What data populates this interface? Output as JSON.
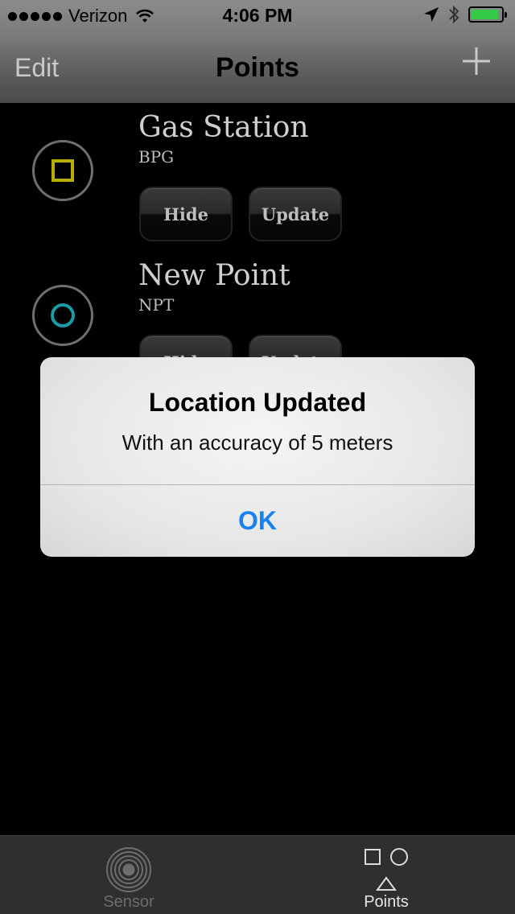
{
  "status_bar": {
    "carrier": "Verizon",
    "time": "4:06 PM"
  },
  "nav": {
    "edit_label": "Edit",
    "title": "Points"
  },
  "points": [
    {
      "name": "Gas Station",
      "code": "BPG",
      "hide_label": "Hide",
      "update_label": "Update",
      "symbol": "square-icon",
      "symbol_color": "#b5b000"
    },
    {
      "name": "New Point",
      "code": "NPT",
      "hide_label": "Hide",
      "update_label": "Update",
      "symbol": "circle-icon",
      "symbol_color": "#1b9aa8"
    }
  ],
  "alert": {
    "title": "Location Updated",
    "message": "With an accuracy of 5 meters",
    "ok_label": "OK"
  },
  "tab_bar": {
    "tabs": [
      {
        "label": "Sensor",
        "icon": "sensor-icon",
        "active": false
      },
      {
        "label": "Points",
        "icon": "shapes-icon",
        "active": true
      }
    ]
  },
  "colors": {
    "alert_button": "#1a82ef",
    "battery": "#35c94a"
  }
}
